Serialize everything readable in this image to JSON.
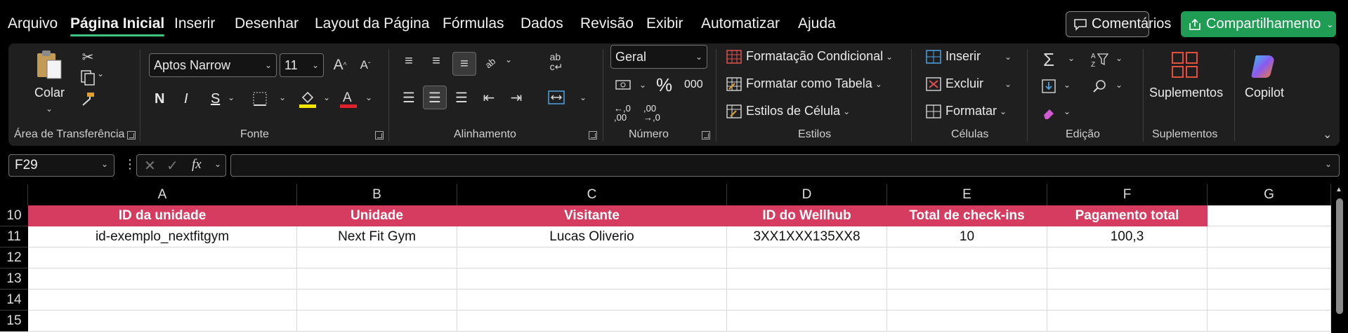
{
  "menu": {
    "items": [
      "Arquivo",
      "Página Inicial",
      "Inserir",
      "Desenhar",
      "Layout da Página",
      "Fórmulas",
      "Dados",
      "Revisão",
      "Exibir",
      "Automatizar",
      "Ajuda"
    ],
    "active": "Página Inicial",
    "comments_label": "Comentários",
    "share_label": "Compartilhamento"
  },
  "ribbon": {
    "clipboard": {
      "paste_label": "Colar",
      "group_label": "Área de Transferência"
    },
    "font": {
      "font_name": "Aptos Narrow",
      "font_size": "11",
      "bold": "N",
      "italic": "I",
      "underline": "S",
      "group_label": "Fonte"
    },
    "alignment": {
      "group_label": "Alinhamento"
    },
    "number": {
      "format": "Geral",
      "percent": "%",
      "thousands": "000",
      "inc_decimal": "←,0 ,00",
      "dec_decimal": ",00 →,0",
      "group_label": "Número"
    },
    "styles": {
      "conditional": "Formatação Condicional",
      "as_table": "Formatar como Tabela",
      "cell_styles": "Estilos de Célula",
      "group_label": "Estilos"
    },
    "cells": {
      "insert": "Inserir",
      "delete": "Excluir",
      "format": "Formatar",
      "group_label": "Células"
    },
    "editing": {
      "group_label": "Edição"
    },
    "addins": {
      "label": "Suplementos",
      "group_label": "Suplementos"
    },
    "copilot": {
      "label": "Copilot"
    }
  },
  "formula_bar": {
    "name_box": "F29",
    "fx": "fx",
    "formula": ""
  },
  "sheet": {
    "columns": [
      "A",
      "B",
      "C",
      "D",
      "E",
      "F",
      "G"
    ],
    "rows": [
      "10",
      "11",
      "12",
      "13",
      "14",
      "15"
    ],
    "header_row": [
      "ID da unidade",
      "Unidade",
      "Visitante",
      "ID do Wellhub",
      "Total de check-ins",
      "Pagamento total"
    ],
    "data_row": [
      "id-exemplo_nextfitgym",
      "Next Fit Gym",
      "Lucas Oliverio",
      "3XX1XXX135XX8",
      "10",
      "100,3"
    ],
    "header_color": "#d63c5f"
  },
  "colors": {
    "accent_green": "#1f9d55",
    "ribbon_bg": "#1f1f1f"
  }
}
